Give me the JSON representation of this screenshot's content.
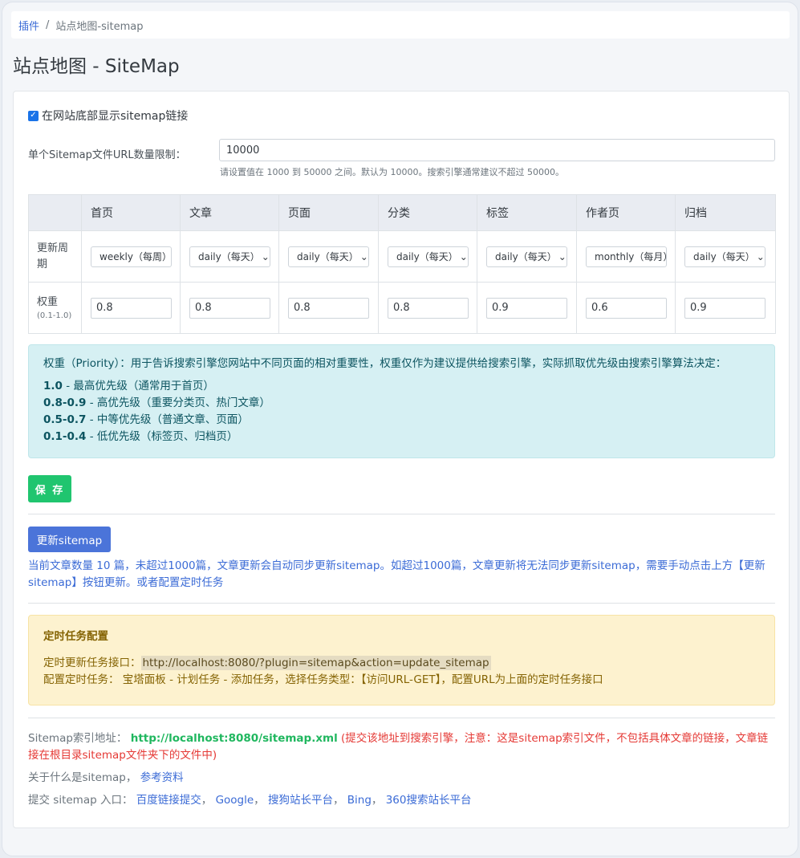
{
  "breadcrumb": {
    "parent": "插件",
    "sep": "/",
    "current": "站点地图-sitemap"
  },
  "page_title": "站点地图 - SiteMap",
  "footer_checkbox": {
    "checked": true,
    "check_glyph": "✓",
    "label": "在网站底部显示sitemap链接"
  },
  "url_limit": {
    "label": "单个Sitemap文件URL数量限制：",
    "value": "10000",
    "help": "请设置值在 1000 到 50000 之间。默认为 10000。搜索引擎通常建议不超过 50000。"
  },
  "table": {
    "columns": [
      "首页",
      "文章",
      "页面",
      "分类",
      "标签",
      "作者页",
      "归档"
    ],
    "freq_label": "更新周期",
    "freq_values": [
      "weekly（每周）",
      "daily（每天）",
      "daily（每天）",
      "daily（每天）",
      "daily（每天）",
      "monthly（每月）",
      "daily（每天）"
    ],
    "priority_label": "权重",
    "priority_range": "(0.1-1.0)",
    "priority_values": [
      "0.8",
      "0.8",
      "0.8",
      "0.8",
      "0.9",
      "0.6",
      "0.9"
    ]
  },
  "info": {
    "intro": "权重（Priority）：用于告诉搜索引擎您网站中不同页面的相对重要性，权重仅作为建议提供给搜索引擎，实际抓取优先级由搜索引擎算法决定：",
    "items": [
      {
        "key": "1.0",
        "desc": " - 最高优先级（通常用于首页）"
      },
      {
        "key": "0.8-0.9",
        "desc": " - 高优先级（重要分类页、热门文章）"
      },
      {
        "key": "0.5-0.7",
        "desc": " - 中等优先级（普通文章、页面）"
      },
      {
        "key": "0.1-0.4",
        "desc": " - 低优先级（标签页、归档页）"
      }
    ]
  },
  "save_label": "保 存",
  "update_label": "更新sitemap",
  "update_note": "当前文章数量 10 篇，未超过1000篇，文章更新会自动同步更新sitemap。如超过1000篇，文章更新将无法同步更新sitemap，需要手动点击上方【更新sitemap】按钮更新。或者配置定时任务",
  "cron": {
    "title": "定时任务配置",
    "url_label": "定时更新任务接口：",
    "url": "http://localhost:8080/?plugin=sitemap&action=update_sitemap",
    "howto": "配置定时任务：  宝塔面板 - 计划任务 - 添加任务，选择任务类型：【访问URL-GET】，配置URL为上面的定时任务接口"
  },
  "footer": {
    "index_label": "Sitemap索引地址：",
    "index_url": "http://localhost:8080/sitemap.xml",
    "index_note": "(提交该地址到搜索引擎，注意：这是sitemap索引文件，不包括具体文章的链接，文章链接在根目录sitemap文件夹下的文件中)",
    "about_label": "关于什么是sitemap，",
    "about_link": "参考资料",
    "submit_label": "提交 sitemap 入口：",
    "submit_links": [
      "百度链接提交",
      "Google",
      "搜狗站长平台",
      "Bing",
      "360搜索站长平台"
    ],
    "submit_sep": "，"
  },
  "icons": {
    "select_chevron": "chevron-down-icon",
    "checkbox": "check-icon"
  },
  "colors": {
    "primary": "#4b74d9",
    "success": "#20c56f",
    "info_bg": "#d6f0f3",
    "warn_bg": "#fdf2cf",
    "danger": "#e53935"
  }
}
